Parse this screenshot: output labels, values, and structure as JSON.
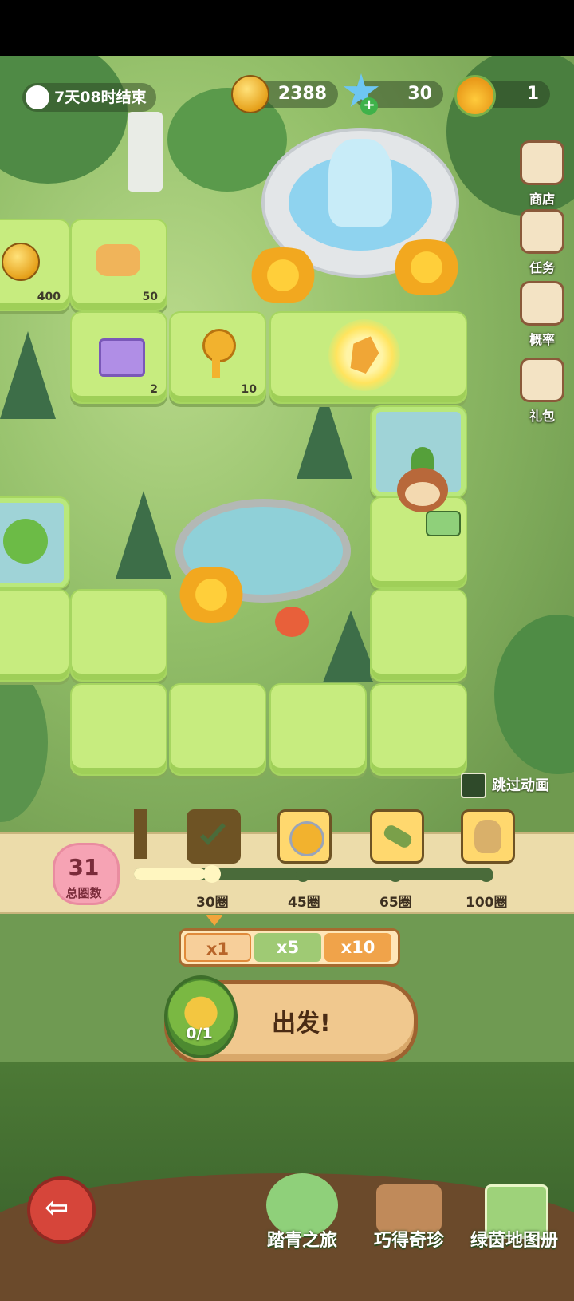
{
  "top_bar": {
    "event_timer": "7天08时结束",
    "coins": "2388",
    "gems": "30",
    "honey": "1"
  },
  "side_menu": [
    {
      "label": "商店",
      "icon": "shop-icon"
    },
    {
      "label": "任务",
      "icon": "task-icon"
    },
    {
      "label": "概率",
      "icon": "probability-icon"
    },
    {
      "label": "礼包",
      "icon": "gift-pack-icon"
    }
  ],
  "board": {
    "tile_rewards": [
      {
        "icon": "star-coin-icon",
        "count": "400"
      },
      {
        "icon": "cat-cookie-icon",
        "count": "50"
      },
      {
        "icon": "purple-chest-icon",
        "count": "2"
      },
      {
        "icon": "golden-key-icon",
        "count": "10"
      },
      {
        "icon": "golden-crystal-icon",
        "count": ""
      }
    ],
    "skip_animation": "跳过动画"
  },
  "progress": {
    "total_laps": "31",
    "total_laps_label": "总圈数",
    "fill_fraction": 0.2,
    "milestones": [
      {
        "label": "30圈",
        "claimed": true,
        "icon": "slingshot-icon"
      },
      {
        "label": "45圈",
        "claimed": false,
        "icon": "star-badge-icon"
      },
      {
        "label": "65圈",
        "claimed": false,
        "icon": "telescope-icon"
      },
      {
        "label": "100圈",
        "claimed": false,
        "icon": "explorer-avatar-icon"
      }
    ]
  },
  "multiplier": {
    "options": [
      "x1",
      "x5",
      "x10"
    ],
    "selected": "x1"
  },
  "go_button": {
    "label": "出发!",
    "ticket": "0/1"
  },
  "bottom_nav": [
    {
      "label": "踏青之旅",
      "icon": "journey-icon"
    },
    {
      "label": "巧得奇珍",
      "icon": "treasure-icon"
    },
    {
      "label": "绿茵地图册",
      "icon": "map-book-icon"
    }
  ],
  "colors": {
    "tile": "#c7ec7f",
    "accent_brown": "#9e6230",
    "strip": "#ecdcaa"
  }
}
